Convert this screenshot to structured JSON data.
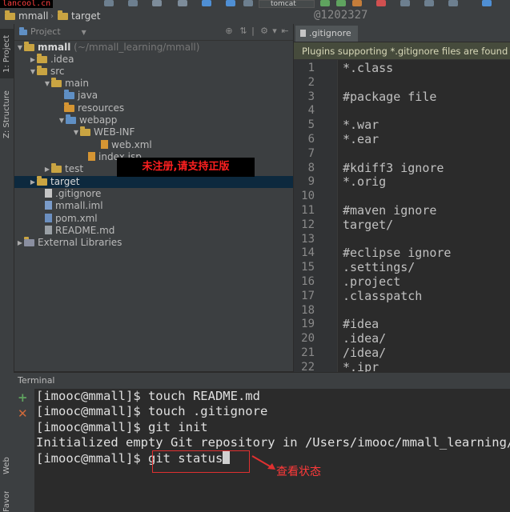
{
  "top_bar": {
    "site_badge": "lancool.cn",
    "crumbs": [
      "mmall",
      "target"
    ],
    "run_config": "tomcat",
    "watermark": "@1202327"
  },
  "left_strip": {
    "tabs": [
      "1: Project",
      "Z: Structure",
      "Web",
      "Favorites"
    ]
  },
  "project_panel": {
    "title": "Project",
    "tree": [
      {
        "label": "mmall",
        "suffix": "(~/mmall_learning/mmall)",
        "depth": 0,
        "expanded": true,
        "icon": "module-folder-icon"
      },
      {
        "label": ".idea",
        "depth": 1,
        "expanded": false,
        "icon": "folder-icon"
      },
      {
        "label": "src",
        "depth": 1,
        "expanded": true,
        "icon": "folder-icon"
      },
      {
        "label": "main",
        "depth": 2,
        "expanded": true,
        "icon": "folder-icon"
      },
      {
        "label": "java",
        "depth": 3,
        "icon": "source-folder-icon"
      },
      {
        "label": "resources",
        "depth": 3,
        "icon": "resources-folder-icon"
      },
      {
        "label": "webapp",
        "depth": 3,
        "expanded": true,
        "icon": "web-folder-icon"
      },
      {
        "label": "WEB-INF",
        "depth": 4,
        "expanded": true,
        "icon": "folder-icon"
      },
      {
        "label": "web.xml",
        "depth": 5,
        "icon": "xml-file-icon"
      },
      {
        "label": "index.jsp",
        "depth": 4,
        "icon": "jsp-file-icon"
      },
      {
        "label": "test",
        "depth": 2,
        "expanded": false,
        "icon": "folder-icon"
      },
      {
        "label": "target",
        "depth": 1,
        "expanded": false,
        "icon": "folder-icon",
        "selected": true
      },
      {
        "label": ".gitignore",
        "depth": 1,
        "icon": "text-file-icon"
      },
      {
        "label": "mmall.iml",
        "depth": 1,
        "icon": "iml-file-icon"
      },
      {
        "label": "pom.xml",
        "depth": 1,
        "icon": "maven-file-icon"
      },
      {
        "label": "README.md",
        "depth": 1,
        "icon": "markdown-file-icon"
      },
      {
        "label": "External Libraries",
        "depth": 0,
        "expanded": false,
        "icon": "library-icon"
      }
    ],
    "overlay_banner": "未注册,请支持正版"
  },
  "editor": {
    "tab_label": ".gitignore",
    "plugin_notice": "Plugins supporting *.gitignore files are found",
    "lines": [
      {
        "n": "1",
        "t": "*.class"
      },
      {
        "n": "2",
        "t": ""
      },
      {
        "n": "3",
        "t": "#package file"
      },
      {
        "n": "4",
        "t": ""
      },
      {
        "n": "5",
        "t": "*.war"
      },
      {
        "n": "6",
        "t": "*.ear"
      },
      {
        "n": "7",
        "t": ""
      },
      {
        "n": "8",
        "t": "#kdiff3 ignore"
      },
      {
        "n": "9",
        "t": "*.orig"
      },
      {
        "n": "10",
        "t": ""
      },
      {
        "n": "11",
        "t": "#maven ignore"
      },
      {
        "n": "12",
        "t": "target/"
      },
      {
        "n": "13",
        "t": ""
      },
      {
        "n": "14",
        "t": "#eclipse ignore"
      },
      {
        "n": "15",
        "t": ".settings/"
      },
      {
        "n": "16",
        "t": ".project"
      },
      {
        "n": "17",
        "t": ".classpatch"
      },
      {
        "n": "18",
        "t": ""
      },
      {
        "n": "19",
        "t": "#idea"
      },
      {
        "n": "20",
        "t": ".idea/"
      },
      {
        "n": "21",
        "t": "/idea/"
      },
      {
        "n": "22",
        "t": "*.ipr"
      }
    ]
  },
  "terminal": {
    "title": "Terminal",
    "lines": [
      "[imooc@mmall]$ touch README.md",
      "[imooc@mmall]$ touch .gitignore",
      "[imooc@mmall]$ git init",
      "Initialized empty Git repository in /Users/imooc/mmall_learning/mmall/.git/"
    ],
    "prompt": "[imooc@mmall]$ ",
    "current_command": "git status",
    "annotation": "查看状态"
  },
  "colors": {
    "accent_red": "#e03030",
    "selection": "#0d293e",
    "panel": "#3c3f41",
    "editor_bg": "#2b2b2b"
  }
}
